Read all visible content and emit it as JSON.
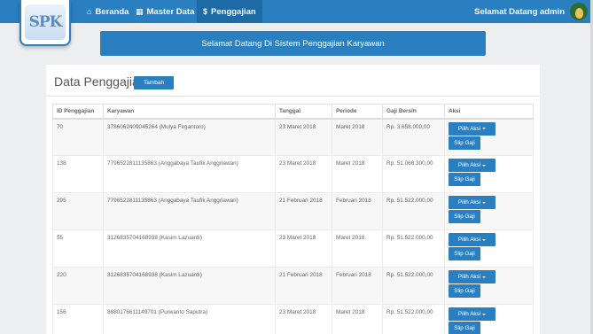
{
  "logo": {
    "text": "SPK"
  },
  "navbar": {
    "items": [
      {
        "label": "Beranda",
        "icon": "home-icon"
      },
      {
        "label": "Master Data",
        "icon": "table-icon"
      },
      {
        "label": "Penggajian",
        "icon": "dollar-icon"
      }
    ],
    "user_label": "Selamat Datang admin"
  },
  "welcome": "Selamat Datang Di Sistem Penggajian Karyawan",
  "panel": {
    "title": "Data Penggajian",
    "add_label": "Tambah"
  },
  "table": {
    "headers": [
      "ID Penggajian",
      "Karyawan",
      "Tanggal",
      "Periode",
      "Gaji Bersih",
      "Aksi"
    ],
    "rows": [
      {
        "id": "70",
        "karyawan": "3786062409045264 (Mulya Firgantoro)",
        "tanggal": "23 Maret 2018",
        "periode": "Maret 2018",
        "gaji": "Rp. 3.658.000,00"
      },
      {
        "id": "138",
        "karyawan": "7796522811135863 (Anggabaya Taufik Anggriawan)",
        "tanggal": "23 Maret 2018",
        "periode": "Maret 2018",
        "gaji": "Rp. 51.066.300,00"
      },
      {
        "id": "295",
        "karyawan": "7796522811135863 (Anggabaya Taufik Anggriawan)",
        "tanggal": "21 Februari 2018",
        "periode": "Februari 2018",
        "gaji": "Rp. 51.522.000,00"
      },
      {
        "id": "55",
        "karyawan": "3126835704168938 (Kasim Lazuardi)",
        "tanggal": "23 Maret 2018",
        "periode": "Maret 2018",
        "gaji": "Rp. 51.522.000,00"
      },
      {
        "id": "220",
        "karyawan": "3126835704168938 (Kasim Lazuardi)",
        "tanggal": "21 Februari 2018",
        "periode": "Februari 2018",
        "gaji": "Rp. 51.522.000,00"
      },
      {
        "id": "156",
        "karyawan": "8680176611149701 (Purwanto Saputra)",
        "tanggal": "23 Maret 2018",
        "periode": "Maret 2018",
        "gaji": "Rp. 51.522.000,00"
      }
    ],
    "pilih_label": "Pilih Aksi",
    "slip_label": "Slip Gaji"
  },
  "colors": {
    "primary": "#2a7fc0",
    "background": "#eceeef"
  }
}
